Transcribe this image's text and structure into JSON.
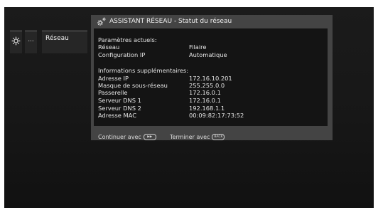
{
  "menu": {
    "settings_icon": "gear-icon",
    "more_label": "...",
    "network_label": "Réseau"
  },
  "dialog": {
    "title_icon": "gears-icon",
    "title": "ASSISTANT RÉSEAU - Statut du réseau",
    "current_heading": "Paramètres actuels:",
    "current": [
      {
        "label": "Réseau",
        "value": "Filaire"
      },
      {
        "label": "Configuration IP",
        "value": "Automatique"
      }
    ],
    "extra_heading": "Informations supplémentaires:",
    "extra": [
      {
        "label": "Adresse IP",
        "value": "172.16.10.201"
      },
      {
        "label": "Masque de sous-réseau",
        "value": "255.255.0.0"
      },
      {
        "label": "Passerelle",
        "value": "172.16.0.1"
      },
      {
        "label": "Serveur DNS 1",
        "value": "172.16.0.1"
      },
      {
        "label": "Serveur DNS 2",
        "value": "192.168.1.1"
      },
      {
        "label": "Adresse MAC",
        "value": "00:09:82:17:73:52"
      }
    ],
    "continue_label": "Continuer avec",
    "continue_key": "▶▶",
    "finish_label": "Terminer avec",
    "finish_key": "BACK"
  }
}
